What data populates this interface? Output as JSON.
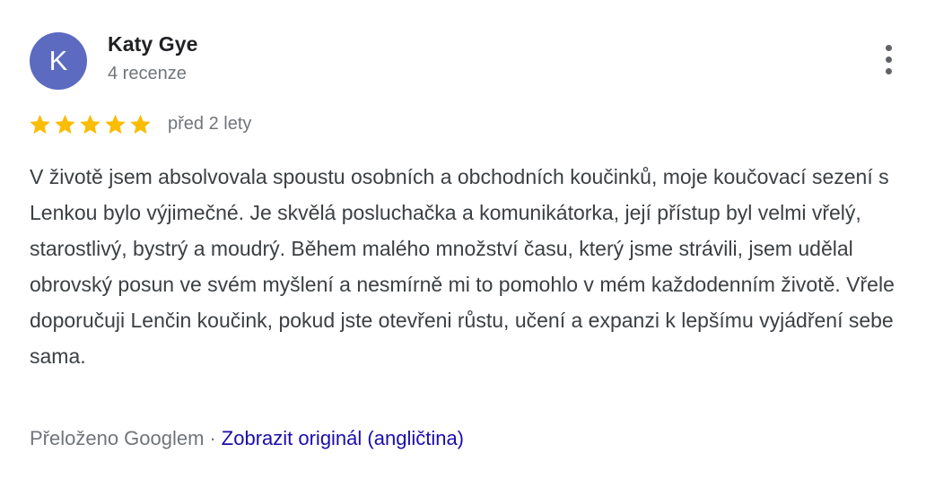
{
  "review": {
    "author": {
      "initial": "K",
      "name": "Katy Gye",
      "meta": "4 recenze",
      "avatar_color": "#5c6bc0"
    },
    "menu_icon": "more-vert-icon",
    "rating": {
      "stars": 5,
      "max": 5,
      "star_color": "#fbbc04",
      "icon": "star-icon"
    },
    "date": "před 2 lety",
    "text": "V životě jsem absolvovala spoustu osobních a obchodních koučinků, moje koučovací sezení s Lenkou bylo výjimečné. Je skvělá posluchačka a komunikátorka, její přístup byl velmi vřelý, starostlivý, bystrý a moudrý. Během malého množství času, který jsme strávili, jsem udělal obrovský posun ve svém myšlení a nesmírně mi to pomohlo v mém každodenním životě. Vřele doporučuji Lenčin koučink, pokud jste otevřeni růstu, učení a expanzi k lepšímu vyjádření sebe sama.",
    "translation": {
      "label": "Přeloženo Googlem",
      "separator": "·",
      "link": "Zobrazit originál (angličtina)",
      "link_color": "#1a0dab"
    }
  }
}
